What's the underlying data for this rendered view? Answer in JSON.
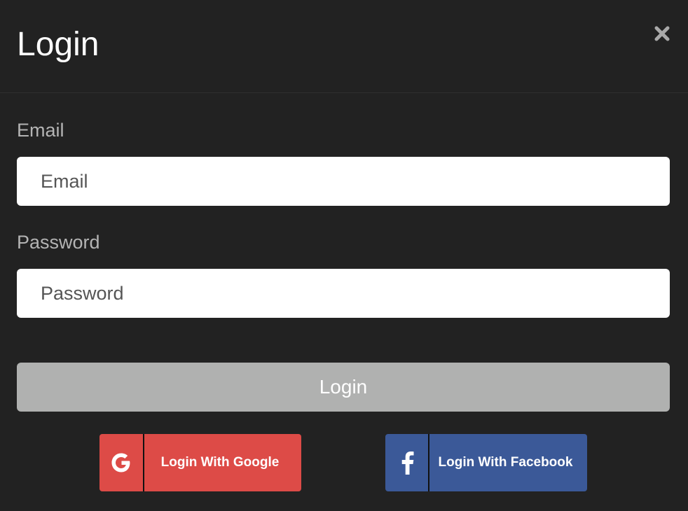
{
  "modal": {
    "title": "Login",
    "close_icon": "close-icon"
  },
  "form": {
    "email": {
      "label": "Email",
      "placeholder": "Email",
      "value": ""
    },
    "password": {
      "label": "Password",
      "placeholder": "Password",
      "value": ""
    },
    "submit_label": "Login"
  },
  "social": {
    "google": {
      "label": "Login With Google",
      "icon": "google-icon",
      "color": "#dd4b47"
    },
    "facebook": {
      "label": "Login With Facebook",
      "icon": "facebook-icon",
      "color": "#3b5998"
    }
  },
  "colors": {
    "background": "#222222",
    "submit_button": "#b0b1b0"
  }
}
